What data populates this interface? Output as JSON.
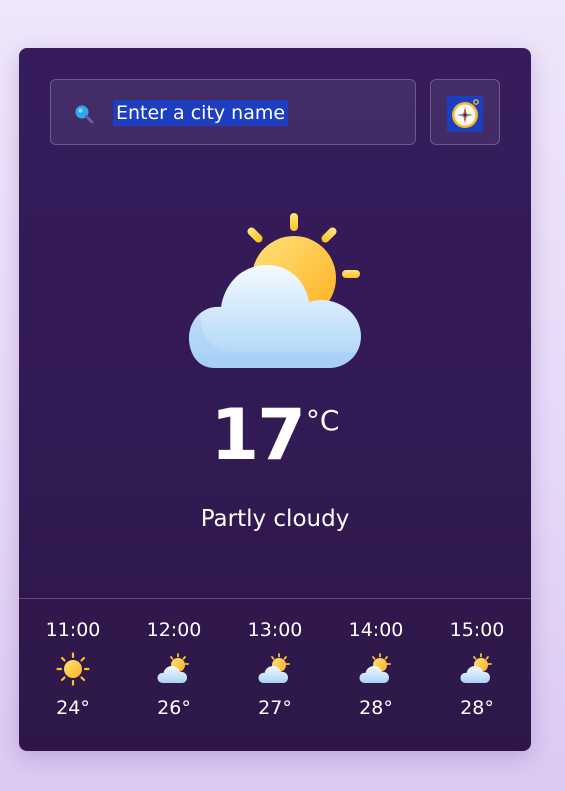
{
  "search": {
    "placeholder": "Enter a city name",
    "value": ""
  },
  "icons": {
    "search": "search-icon",
    "locate": "compass-icon",
    "current": "partly-cloudy-icon"
  },
  "current": {
    "temperature": "17",
    "unit": "°C",
    "condition": "Partly cloudy"
  },
  "hourly": [
    {
      "time": "11:00",
      "icon": "sun-icon",
      "temp": "24°"
    },
    {
      "time": "12:00",
      "icon": "partly-cloudy-icon",
      "temp": "26°"
    },
    {
      "time": "13:00",
      "icon": "partly-cloudy-icon",
      "temp": "27°"
    },
    {
      "time": "14:00",
      "icon": "partly-cloudy-icon",
      "temp": "28°"
    },
    {
      "time": "15:00",
      "icon": "partly-cloudy-icon",
      "temp": "28°"
    }
  ],
  "colors": {
    "card_background": "#351b5a",
    "highlight": "#1d3fbf",
    "sun": "#ffc93a",
    "cloud": "#d6ecff"
  }
}
